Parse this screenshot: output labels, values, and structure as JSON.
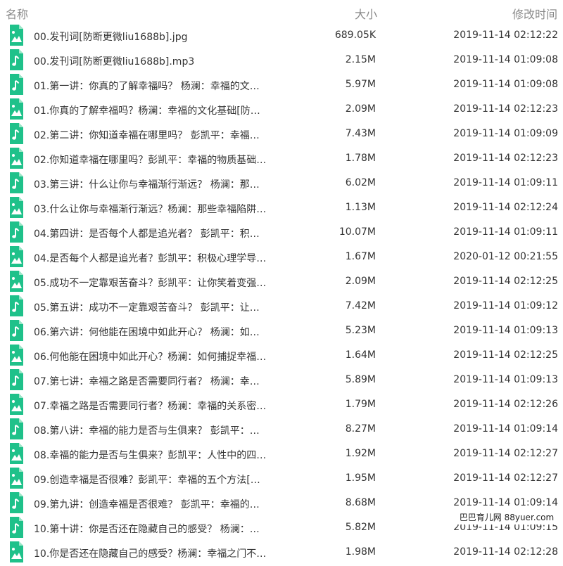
{
  "header": {
    "name": "名称",
    "size": "大小",
    "time": "修改时间"
  },
  "files": [
    {
      "name": "00.发刊词[防断更微liu1688b].jpg",
      "size": "689.05K",
      "time": "2019-11-14 02:12:22",
      "icon": "image-file-icon"
    },
    {
      "name": "00.发刊词[防断更微liu1688b].mp3",
      "size": "2.15M",
      "time": "2019-11-14 01:09:08",
      "icon": "audio-file-icon"
    },
    {
      "name": "01.第一讲：你真的了解幸福吗？ 杨澜：幸福的文…",
      "size": "5.97M",
      "time": "2019-11-14 01:09:08",
      "icon": "audio-file-icon"
    },
    {
      "name": "01.你真的了解幸福吗？杨澜：幸福的文化基础[防…",
      "size": "2.09M",
      "time": "2019-11-14 02:12:23",
      "icon": "image-file-icon"
    },
    {
      "name": "02.第二讲：你知道幸福在哪里吗？ 彭凯平：幸福…",
      "size": "7.43M",
      "time": "2019-11-14 01:09:09",
      "icon": "audio-file-icon"
    },
    {
      "name": "02.你知道幸福在哪里吗？彭凯平：幸福的物质基础…",
      "size": "1.78M",
      "time": "2019-11-14 02:12:23",
      "icon": "image-file-icon"
    },
    {
      "name": "03.第三讲：什么让你与幸福渐行渐远？ 杨澜：那…",
      "size": "6.02M",
      "time": "2019-11-14 01:09:11",
      "icon": "audio-file-icon"
    },
    {
      "name": "03.什么让你与幸福渐行渐远？杨澜：那些幸福陷阱…",
      "size": "1.13M",
      "time": "2019-11-14 02:12:24",
      "icon": "image-file-icon"
    },
    {
      "name": "04.第四讲：是否每个人都是追光者？ 彭凯平：积…",
      "size": "10.07M",
      "time": "2019-11-14 01:09:11",
      "icon": "audio-file-icon"
    },
    {
      "name": "04.是否每个人都是追光者？彭凯平：积极心理学导…",
      "size": "1.67M",
      "time": "2020-01-12 00:21:55",
      "icon": "image-file-icon"
    },
    {
      "name": "05.成功不一定靠艰苦奋斗？彭凯平：让你笑着变强…",
      "size": "2.09M",
      "time": "2019-11-14 02:12:25",
      "icon": "image-file-icon"
    },
    {
      "name": "05.第五讲：成功不一定靠艰苦奋斗？ 彭凯平：让…",
      "size": "7.42M",
      "time": "2019-11-14 01:09:12",
      "icon": "audio-file-icon"
    },
    {
      "name": "06.第六讲：何他能在困境中如此开心？ 杨澜：如…",
      "size": "5.23M",
      "time": "2019-11-14 01:09:13",
      "icon": "audio-file-icon"
    },
    {
      "name": "06.何他能在困境中如此开心？杨澜：如何捕捉幸福…",
      "size": "1.64M",
      "time": "2019-11-14 02:12:25",
      "icon": "image-file-icon"
    },
    {
      "name": "07.第七讲：幸福之路是否需要同行者？ 杨澜：幸…",
      "size": "5.89M",
      "time": "2019-11-14 01:09:13",
      "icon": "audio-file-icon"
    },
    {
      "name": "07.幸福之路是否需要同行者？杨澜：幸福的关系密…",
      "size": "1.79M",
      "time": "2019-11-14 02:12:26",
      "icon": "image-file-icon"
    },
    {
      "name": "08.第八讲：幸福的能力是否与生俱来？ 彭凯平：…",
      "size": "8.27M",
      "time": "2019-11-14 01:09:14",
      "icon": "audio-file-icon"
    },
    {
      "name": "08.幸福的能力是否与生俱来？彭凯平：人性中的四…",
      "size": "1.92M",
      "time": "2019-11-14 02:12:27",
      "icon": "image-file-icon"
    },
    {
      "name": "09.创造幸福是否很难？彭凯平：幸福的五个方法[…",
      "size": "1.95M",
      "time": "2019-11-14 02:12:27",
      "icon": "image-file-icon"
    },
    {
      "name": "09.第九讲：创造幸福是否很难？ 彭凯平：幸福的…",
      "size": "8.68M",
      "time": "2019-11-14 01:09:14",
      "icon": "audio-file-icon"
    },
    {
      "name": "10.第十讲：你是否还在隐藏自己的感受？ 杨澜：…",
      "size": "5.82M",
      "time": "2019-11-14 01:09:15",
      "icon": "audio-file-icon"
    },
    {
      "name": "10.你是否还在隐藏自己的感受？杨澜：幸福之门不…",
      "size": "1.98M",
      "time": "2019-11-14 02:12:28",
      "icon": "image-file-icon"
    }
  ],
  "watermark": "巴巴育儿网 88yuer.com",
  "colors": {
    "icon_green": "#1fc18a",
    "header_text": "#8a8a8a",
    "row_text": "#333333"
  }
}
